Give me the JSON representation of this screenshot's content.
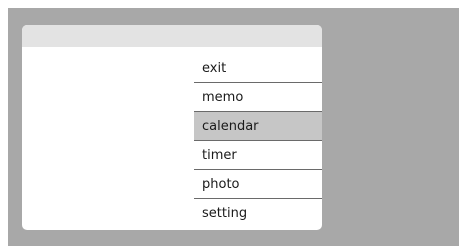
{
  "menu": {
    "items": [
      {
        "label": "exit"
      },
      {
        "label": "memo"
      },
      {
        "label": "calendar",
        "selected": true
      },
      {
        "label": "timer"
      },
      {
        "label": "photo"
      },
      {
        "label": "setting"
      }
    ]
  },
  "colors": {
    "background": "#a8a8a8",
    "header": "#e3e3e3",
    "selected": "#c6c6c6"
  }
}
